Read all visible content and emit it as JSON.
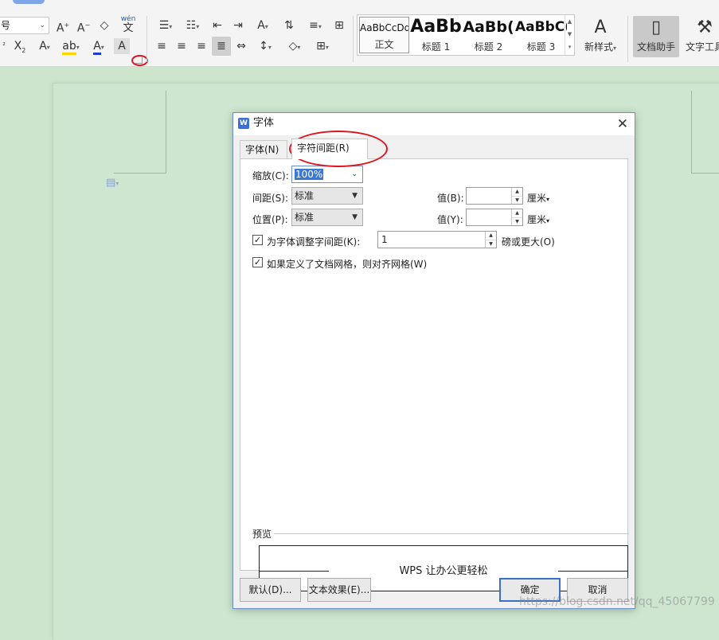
{
  "ribbon": {
    "font_size_value": "号",
    "styles": [
      {
        "sample": "AaBbCcDd",
        "name": "正文"
      },
      {
        "sample": "AaBb",
        "name": "标题 1"
      },
      {
        "sample": "AaBb(",
        "name": "标题 2"
      },
      {
        "sample": "AaBbC(",
        "name": "标题 3"
      }
    ],
    "new_style_label": "新样式",
    "doc_assistant_label": "文档助手",
    "text_tools_label": "文字工具",
    "phonetic_glyph": "wén",
    "phonetic_char": "文"
  },
  "dialog": {
    "title": "字体",
    "tabs": [
      {
        "label": "字体(N)"
      },
      {
        "label": "字符间距(R)"
      }
    ],
    "scale_label": "缩放(C):",
    "scale_value": "100%",
    "spacing_label": "间距(S):",
    "spacing_value": "标准",
    "spacing_by_label": "值(B):",
    "spacing_by_value": "",
    "spacing_unit": "厘米",
    "position_label": "位置(P):",
    "position_value": "标准",
    "position_by_label": "值(Y):",
    "position_by_value": "",
    "position_unit": "厘米",
    "kerning_label": "为字体调整字间距(K):",
    "kerning_checked": true,
    "kerning_value": "1",
    "kerning_suffix": "磅或更大(O)",
    "grid_label": "如果定义了文档网格，则对齐网格(W)",
    "grid_checked": true,
    "preview_label": "预览",
    "preview_text": "WPS 让办公更轻松",
    "buttons": {
      "default": "默认(D)...",
      "text_effects": "文本效果(E)...",
      "ok": "确定",
      "cancel": "取消"
    }
  },
  "watermark": "https://blog.csdn.net/qq_45067799",
  "colors": {
    "accent": "#3a6fc4",
    "highlight_circle": "#e0141e",
    "page_bg": "#cde5cc"
  }
}
